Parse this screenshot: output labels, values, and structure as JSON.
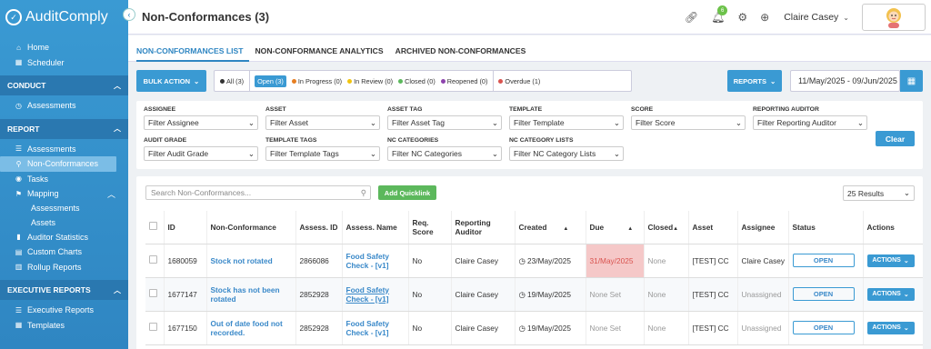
{
  "app": {
    "logo": "AuditComply",
    "page_title": "Non-Conformances (3)"
  },
  "sidebar": {
    "top_items": [
      {
        "label": "Home",
        "icon": "home-icon"
      },
      {
        "label": "Scheduler",
        "icon": "calendar-icon"
      }
    ],
    "sections": [
      {
        "title": "CONDUCT",
        "items": [
          {
            "label": "Assessments"
          }
        ]
      },
      {
        "title": "REPORT",
        "items": [
          {
            "label": "Assessments"
          },
          {
            "label": "Non-Conformances"
          },
          {
            "label": "Tasks"
          },
          {
            "label": "Mapping"
          }
        ],
        "sub_items": [
          "Assessments",
          "Assets"
        ],
        "more_items": [
          "Auditor Statistics",
          "Custom Charts",
          "Rollup Reports"
        ]
      },
      {
        "title": "EXECUTIVE REPORTS",
        "items": [
          {
            "label": "Executive Reports"
          },
          {
            "label": "Templates"
          }
        ]
      }
    ]
  },
  "header": {
    "notification_count": "6",
    "user_name": "Claire Casey"
  },
  "tabs": [
    {
      "label": "NON-CONFORMANCES LIST"
    },
    {
      "label": "NON-CONFORMANCE ANALYTICS"
    },
    {
      "label": "ARCHIVED NON-CONFORMANCES"
    }
  ],
  "toolbar": {
    "bulk_action": "BULK ACTION",
    "statuses": [
      {
        "label": "All (3)",
        "color": "#333333"
      },
      {
        "label": "Open (3)",
        "color": "#3a9ad3"
      },
      {
        "label": "In Progress (0)",
        "color": "#e67e22"
      },
      {
        "label": "In Review (0)",
        "color": "#f1c40f"
      },
      {
        "label": "Closed (0)",
        "color": "#5cb85c"
      },
      {
        "label": "Reopened (0)",
        "color": "#8e44ad"
      },
      {
        "label": "Overdue (1)",
        "color": "#d9534f"
      }
    ],
    "reports": "REPORTS",
    "date_range": "11/May/2025 - 09/Jun/2025"
  },
  "filters": [
    {
      "label": "ASSIGNEE",
      "placeholder": "Filter Assignee"
    },
    {
      "label": "ASSET",
      "placeholder": "Filter Asset"
    },
    {
      "label": "ASSET TAG",
      "placeholder": "Filter Asset Tag"
    },
    {
      "label": "TEMPLATE",
      "placeholder": "Filter Template"
    },
    {
      "label": "SCORE",
      "placeholder": "Filter Score"
    },
    {
      "label": "REPORTING AUDITOR",
      "placeholder": "Filter Reporting Auditor"
    },
    {
      "label": "AUDIT GRADE",
      "placeholder": "Filter Audit Grade"
    },
    {
      "label": "TEMPLATE TAGS",
      "placeholder": "Filter Template Tags"
    },
    {
      "label": "NC CATEGORIES",
      "placeholder": "Filter NC Categories"
    },
    {
      "label": "NC CATEGORY LISTS",
      "placeholder": "Filter NC Category Lists"
    }
  ],
  "clear_label": "Clear",
  "table": {
    "search_placeholder": "Search Non-Conformances...",
    "quicklink": "Add Quicklink",
    "results": "25 Results",
    "columns": [
      "ID",
      "Non-Conformance",
      "Assess. ID",
      "Assess. Name",
      "Req. Score",
      "Reporting Auditor",
      "Created",
      "Due",
      "Closed",
      "Asset",
      "Assignee",
      "Status",
      "Actions"
    ],
    "rows": [
      {
        "id": "1680059",
        "nc": "Stock not rotated",
        "assess_id": "2866086",
        "assess_name": "Food Safety Check - [v1]",
        "score": "No",
        "auditor": "Claire Casey",
        "created": "23/May/2025",
        "due": "31/May/2025",
        "closed": "None",
        "asset": "[TEST] CC",
        "assignee": "Claire Casey",
        "status": "OPEN",
        "actions": "ACTIONS"
      },
      {
        "id": "1677147",
        "nc": "Stock has not been rotated",
        "assess_id": "2852928",
        "assess_name": "Food Safety Check - [v1]",
        "score": "No",
        "auditor": "Claire Casey",
        "created": "19/May/2025",
        "due": "None Set",
        "closed": "None",
        "asset": "[TEST] CC",
        "assignee": "Unassigned",
        "status": "OPEN",
        "actions": "ACTIONS"
      },
      {
        "id": "1677150",
        "nc": "Out of date food not recorded.",
        "assess_id": "2852928",
        "assess_name": "Food Safety Check - [v1]",
        "score": "No",
        "auditor": "Claire Casey",
        "created": "19/May/2025",
        "due": "None Set",
        "closed": "None",
        "asset": "[TEST] CC",
        "assignee": "Unassigned",
        "status": "OPEN",
        "actions": "ACTIONS"
      }
    ]
  }
}
